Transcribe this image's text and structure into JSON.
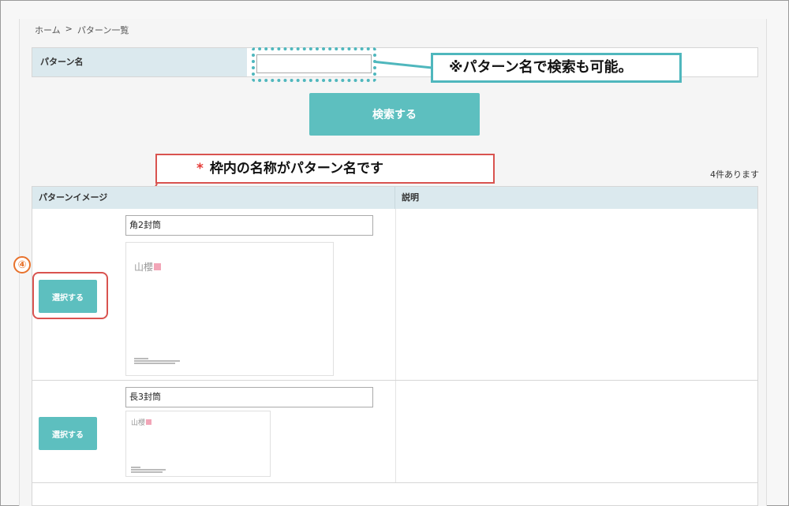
{
  "breadcrumb": {
    "home": "ホーム",
    "separator": ">",
    "current": "パターン一覧"
  },
  "search": {
    "label": "パターン名",
    "input_value": "",
    "button_label": "検索する"
  },
  "annotations": {
    "search_note": "※パターン名で検索も可能。",
    "name_note_mark": "*",
    "name_note": "枠内の名称がパターン名です",
    "step_number": "④"
  },
  "results": {
    "count_text": "4件あります",
    "columns": {
      "image": "パターンイメージ",
      "description": "説明"
    },
    "rows": [
      {
        "pattern_name": "角2封筒",
        "select_label": "選択する",
        "preview_logo": "山櫻",
        "description": ""
      },
      {
        "pattern_name": "長3封筒",
        "select_label": "選択する",
        "preview_logo": "山櫻",
        "description": ""
      }
    ]
  },
  "colors": {
    "accent": "#5dbfbf",
    "header_bg": "#dbe9ee",
    "highlight_red": "#d9534f",
    "step_orange": "#e8722c",
    "logo_pink": "#f2a5b7"
  }
}
